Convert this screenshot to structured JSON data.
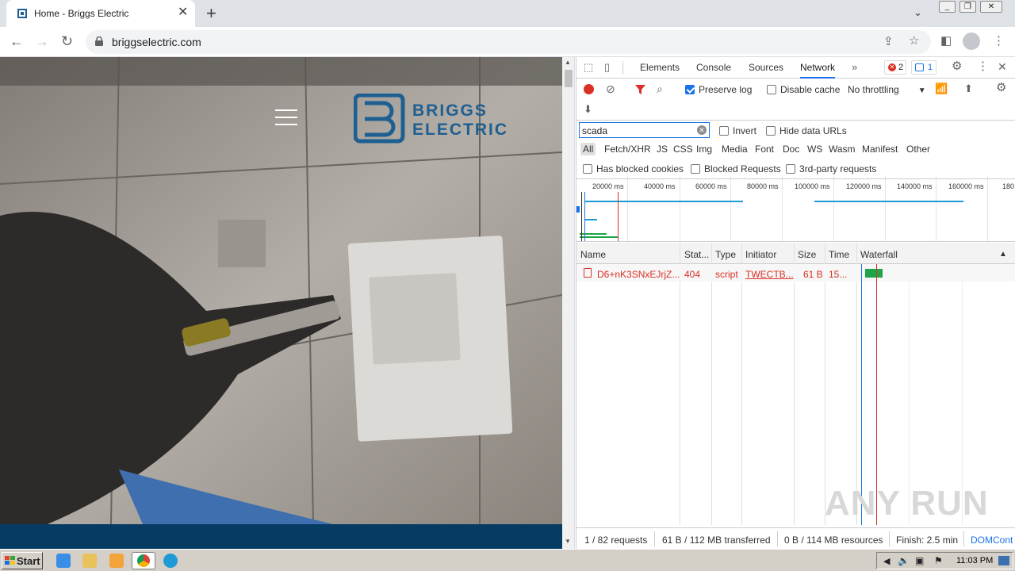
{
  "browser": {
    "tab_title": "Home - Briggs Electric",
    "url": "briggselectric.com"
  },
  "site": {
    "logo_line1": "BRIGGS",
    "logo_line2": "ELECTRIC",
    "brand_color": "#1e5f92"
  },
  "devtools": {
    "tabs": [
      "Elements",
      "Console",
      "Sources",
      "Network"
    ],
    "active_tab": "Network",
    "errors_count": "2",
    "messages_count": "1",
    "toolbar": {
      "preserve_log": "Preserve log",
      "disable_cache": "Disable cache",
      "throttling": "No throttling"
    },
    "filter": {
      "value": "scada",
      "invert": "Invert",
      "hide_data_urls": "Hide data URLs"
    },
    "filter_types": [
      "All",
      "Fetch/XHR",
      "JS",
      "CSS",
      "Img",
      "Media",
      "Font",
      "Doc",
      "WS",
      "Wasm",
      "Manifest",
      "Other"
    ],
    "extra_filters": [
      "Has blocked cookies",
      "Blocked Requests",
      "3rd-party requests"
    ],
    "timeline_ticks": [
      "20000 ms",
      "40000 ms",
      "60000 ms",
      "80000 ms",
      "100000 ms",
      "120000 ms",
      "140000 ms",
      "160000 ms",
      "180"
    ],
    "columns": [
      "Name",
      "Stat...",
      "Type",
      "Initiator",
      "Size",
      "Time",
      "Waterfall"
    ],
    "rows": [
      {
        "name": "D6+nK3SNxEJrjZ...",
        "status": "404",
        "type": "script",
        "initiator": "TWECTB...",
        "size": "61 B",
        "time": "15..."
      }
    ],
    "status_bar": {
      "requests": "1 / 82 requests",
      "transferred": "61 B / 112 MB transferred",
      "resources": "0 B / 114 MB resources",
      "finish": "Finish: 2.5 min",
      "domcont": "DOMCont"
    }
  },
  "watermark": "ANY RUN",
  "taskbar": {
    "start_label": "Start",
    "clock": "11:03 PM"
  }
}
